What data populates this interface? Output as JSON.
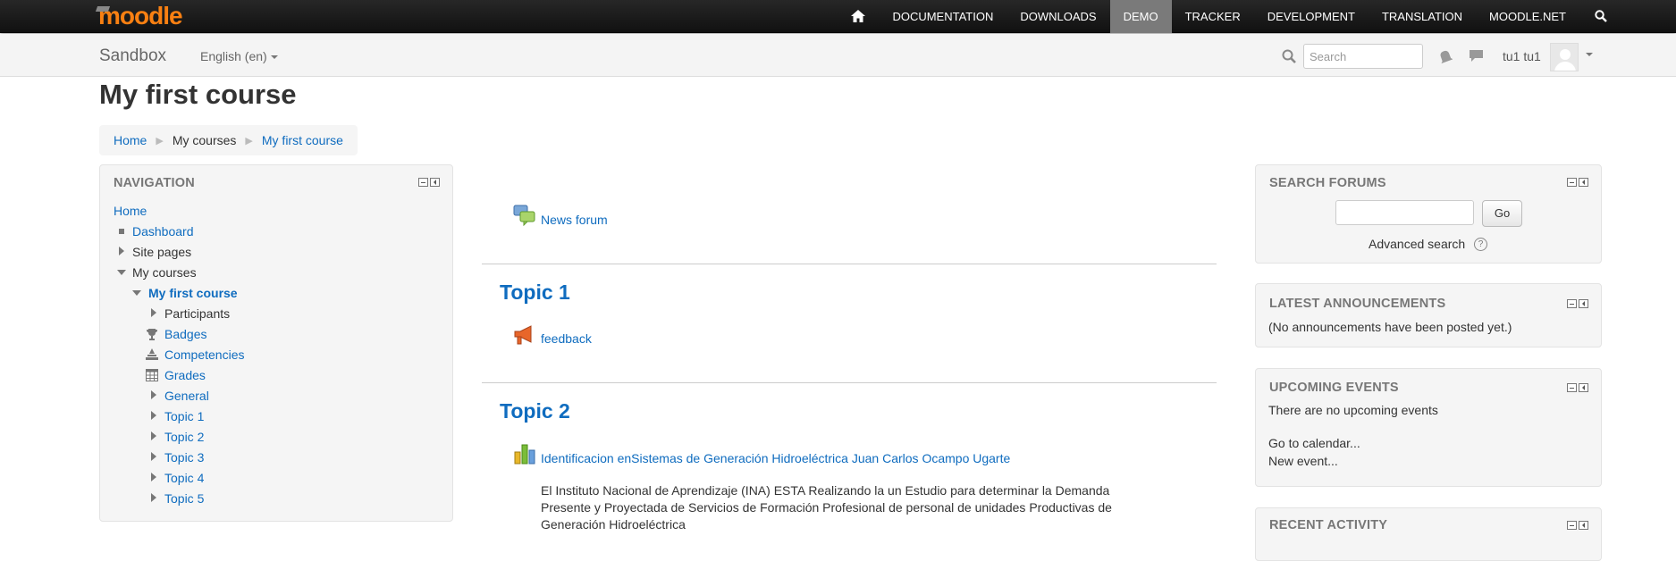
{
  "brand": {
    "logo_text": "moodle",
    "accent": "#f98012"
  },
  "topnav": {
    "items": [
      "DOCUMENTATION",
      "DOWNLOADS",
      "DEMO",
      "TRACKER",
      "DEVELOPMENT",
      "TRANSLATION",
      "MOODLE.NET"
    ],
    "active": "DEMO",
    "home_icon": "home-icon",
    "search_icon": "search-icon"
  },
  "header": {
    "site_name": "Sandbox",
    "language": "English (en)",
    "search_placeholder": "Search",
    "user_name": "tu1 tu1"
  },
  "page": {
    "title": "My first course",
    "breadcrumb": [
      "Home",
      "My courses",
      "My first course"
    ]
  },
  "navigation": {
    "title": "NAVIGATION",
    "items": [
      "Home",
      "Dashboard",
      "Site pages",
      "My courses",
      "My first course",
      "Participants",
      "Badges",
      "Competencies",
      "Grades",
      "General",
      "Topic 1",
      "Topic 2",
      "Topic 3",
      "Topic 4",
      "Topic 5"
    ]
  },
  "course": {
    "news_forum": "News forum",
    "topic1": {
      "title": "Topic 1",
      "activity": "feedback"
    },
    "topic2": {
      "title": "Topic 2",
      "activity": "Identificacion enSistemas de Generación Hidroeléctrica Juan Carlos Ocampo Ugarte",
      "summary": "El Instituto Nacional de Aprendizaje (INA) ESTA Realizando la un Estudio para determinar  la Demanda Presente y Proyectada de Servicios de Formación Profesional de personal de unidades Productivas de Generación Hidroeléctrica"
    }
  },
  "blocks": {
    "search_forums": {
      "title": "SEARCH FORUMS",
      "go": "Go",
      "advanced": "Advanced search"
    },
    "latest_announcements": {
      "title": "LATEST ANNOUNCEMENTS",
      "text": "(No announcements have been posted yet.)"
    },
    "upcoming_events": {
      "title": "UPCOMING EVENTS",
      "text": "There are no upcoming events",
      "calendar_link": "Go to calendar...",
      "new_event_link": "New event..."
    },
    "recent_activity": {
      "title": "RECENT ACTIVITY"
    }
  }
}
